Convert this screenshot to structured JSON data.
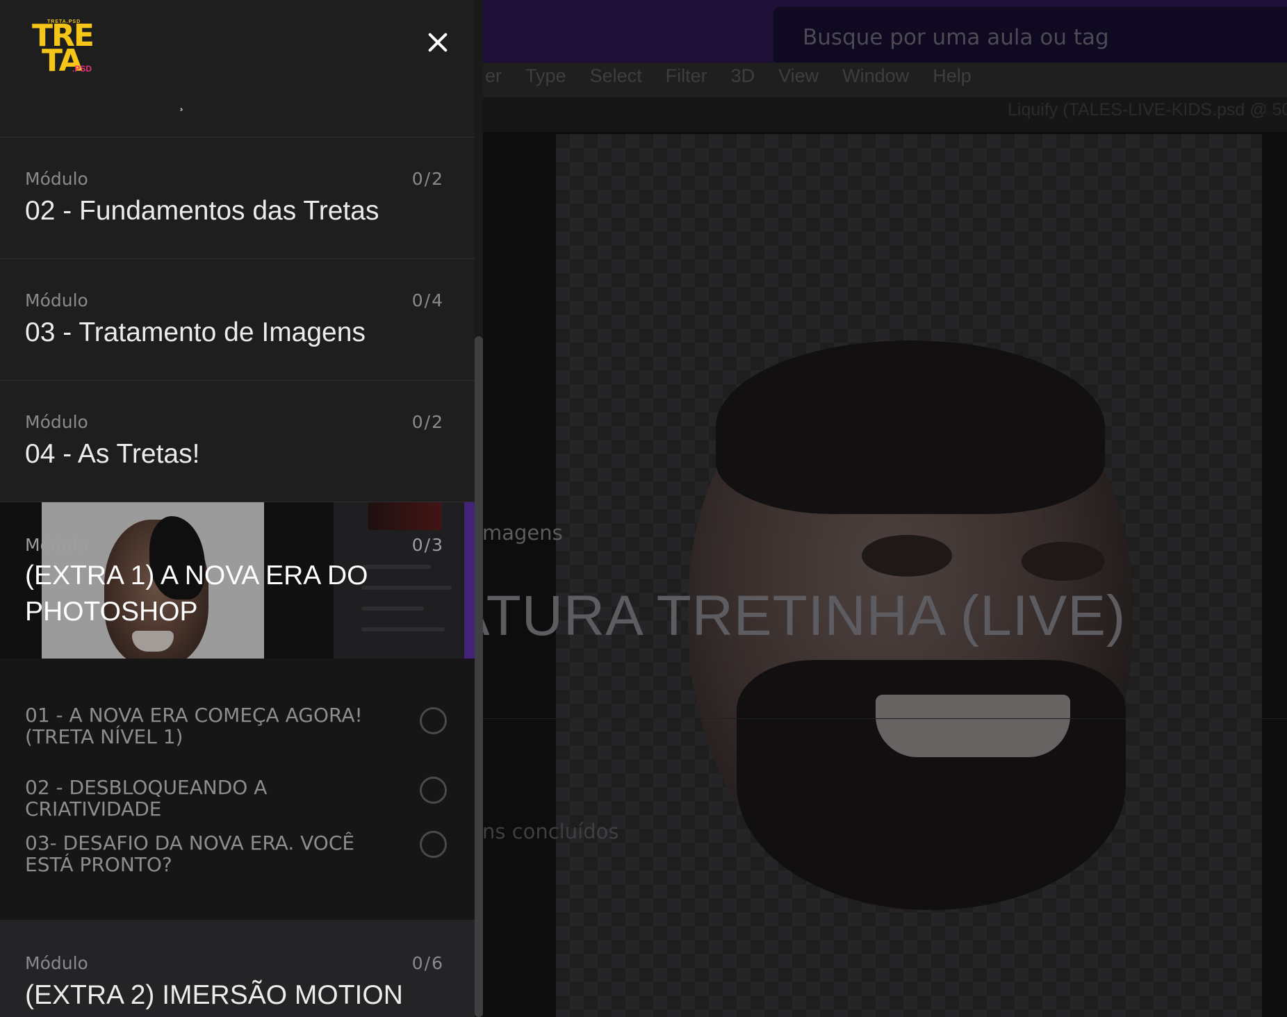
{
  "background": {
    "search_placeholder": "Busque por uma aula ou tag",
    "menu": [
      "er",
      "Type",
      "Select",
      "Filter",
      "3D",
      "View",
      "Window",
      "Help"
    ],
    "doc_title": "Liquify (TALES-LIVE-KIDS.psd @ 50",
    "label_imagens": "magens",
    "course_title": "ATURA TRETINHA (LIVE)",
    "label_concluidos": "ns concluídos",
    "colors": {
      "topbar": "#2a1650",
      "search_bg": "#160d2e"
    }
  },
  "sidebar": {
    "logo": {
      "tagline": "TRETA.PSD",
      "line1": "TRE",
      "line2": "TA",
      "suffix": ".PSD",
      "colors": {
        "primary": "#f5c518",
        "accent": "#e8307e"
      }
    },
    "close_icon": "close-icon",
    "header_mark": "¸",
    "modules": [
      {
        "kicker": "Módulo",
        "title": "02 - Fundamentos das Tretas",
        "count": "0/2"
      },
      {
        "kicker": "Módulo",
        "title": "03 - Tratamento de Imagens",
        "count": "0/4"
      },
      {
        "kicker": "Módulo",
        "title": "04 - As Tretas!",
        "count": "0/2"
      }
    ],
    "active_module": {
      "kicker": "Módulo",
      "title": "(EXTRA 1) A NOVA ERA DO PHOTOSHOP",
      "count": "0/3",
      "lessons": [
        {
          "title": "01 - A NOVA ERA COMEÇA AGORA! (TRETA NÍVEL 1)",
          "completed": false
        },
        {
          "title": "02 - DESBLOQUEANDO A CRIATIVIDADE",
          "completed": false
        },
        {
          "title": "03- DESAFIO DA NOVA ERA. VOCÊ ESTÁ PRONTO?",
          "completed": false
        }
      ]
    },
    "next_module": {
      "kicker": "Módulo",
      "title": "(EXTRA 2) IMERSÃO MOTION",
      "count": "0/6"
    }
  }
}
